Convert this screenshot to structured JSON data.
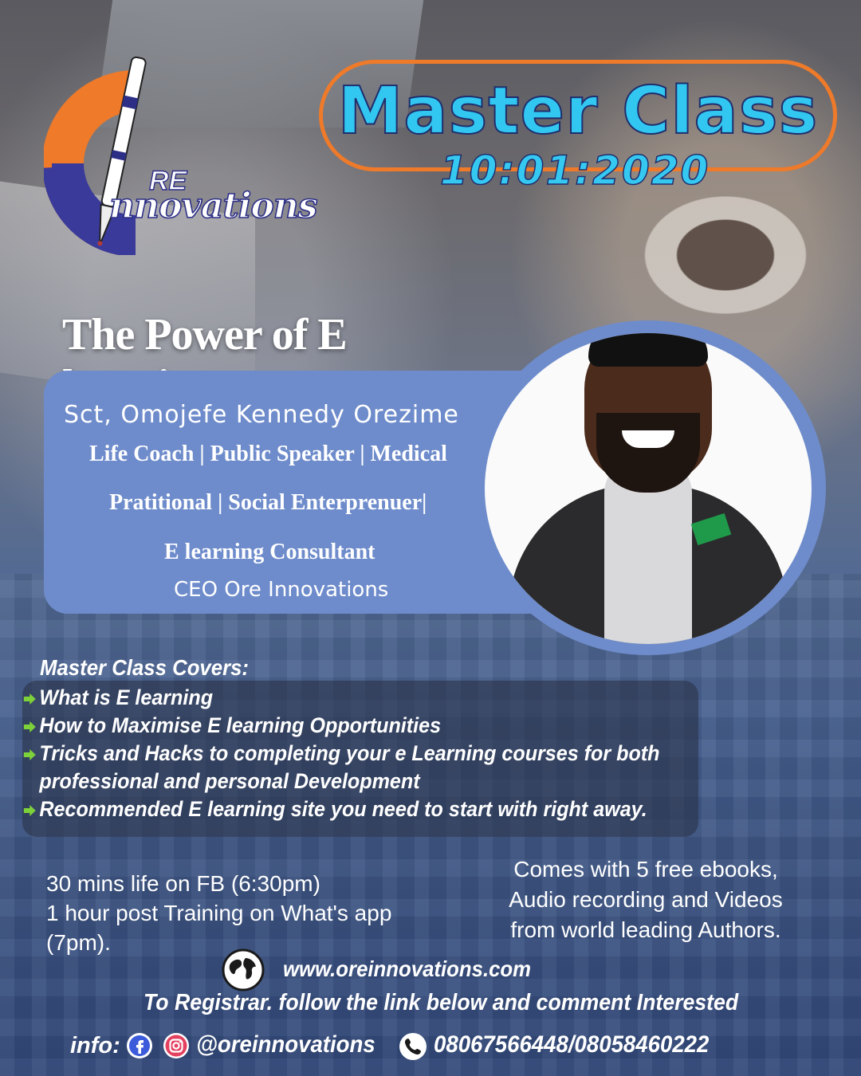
{
  "logo": {
    "prefix": "RE",
    "word": "nnovations"
  },
  "header": {
    "title": "Master Class",
    "date": "10:01:2020"
  },
  "topic": "The Power of E learning",
  "speaker": {
    "name": "Sct, Omojefe Kennedy Orezime",
    "roles": [
      "Life Coach | Public Speaker | Medical",
      "Pratitional | Social Enterprenuer|",
      "E learning Consultant",
      "CEO Ore Innovations"
    ]
  },
  "covers": {
    "heading": "Master Class Covers:",
    "items": [
      "What is E learning",
      "How to Maximise E learning Opportunities",
      "Tricks and Hacks to completing your e Learning courses for both professional and personal Development",
      "Recommended E learning site you need to start with right away."
    ]
  },
  "schedule": [
    "30 mins life on FB (6:30pm)",
    "1 hour post Training on What's app",
    "(7pm)."
  ],
  "bonus": [
    "Comes with 5 free ebooks,",
    "Audio recording and Videos",
    "from world leading Authors."
  ],
  "website": "www.oreinnovations.com",
  "register_text": "To Registrar. follow the link below and comment Interested",
  "footer": {
    "info_label": "info:",
    "handle": "@oreinnovations",
    "phones": "08067566448/08058460222"
  },
  "colors": {
    "accent_orange": "#ee7a2a",
    "title_cyan": "#31c7f0",
    "card_blue": "#6e8ccb",
    "bullet_green": "#7dd23a",
    "logo_navy": "#2d2f86"
  }
}
